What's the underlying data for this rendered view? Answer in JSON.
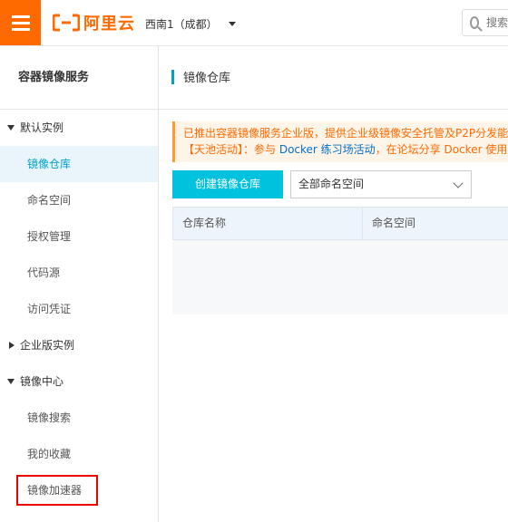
{
  "topbar": {
    "logo_text": "阿里云",
    "region": "西南1（成都）",
    "search_placeholder": "搜索"
  },
  "sidebar": {
    "title": "容器镜像服务",
    "groups": [
      {
        "label": "默认实例",
        "expanded": true,
        "items": [
          "镜像仓库",
          "命名空间",
          "授权管理",
          "代码源",
          "访问凭证"
        ]
      },
      {
        "label": "企业版实例",
        "expanded": false,
        "items": []
      },
      {
        "label": "镜像中心",
        "expanded": true,
        "items": [
          "镜像搜索",
          "我的收藏",
          "镜像加速器"
        ]
      }
    ],
    "active_item": "镜像仓库",
    "highlighted_item": "镜像加速器"
  },
  "main": {
    "title": "镜像仓库",
    "notice": {
      "line1": "已推出容器镜像服务企业版，提供企业级镜像安全托管及P2P分发能",
      "line2_prefix": "【天池活动】：参与 ",
      "line2_link": "Docker 练习场活动",
      "line2_suffix": "，在论坛分享 Docker 使用心"
    },
    "create_button": "创建镜像仓库",
    "namespace_select": "全部命名空间",
    "table": {
      "columns": [
        "仓库名称",
        "命名空间"
      ]
    }
  },
  "colors": {
    "brand_orange": "#ff6a00",
    "accent_blue": "#00c1de",
    "active_text": "#00a2ca",
    "highlight_box": "#ee0000"
  }
}
